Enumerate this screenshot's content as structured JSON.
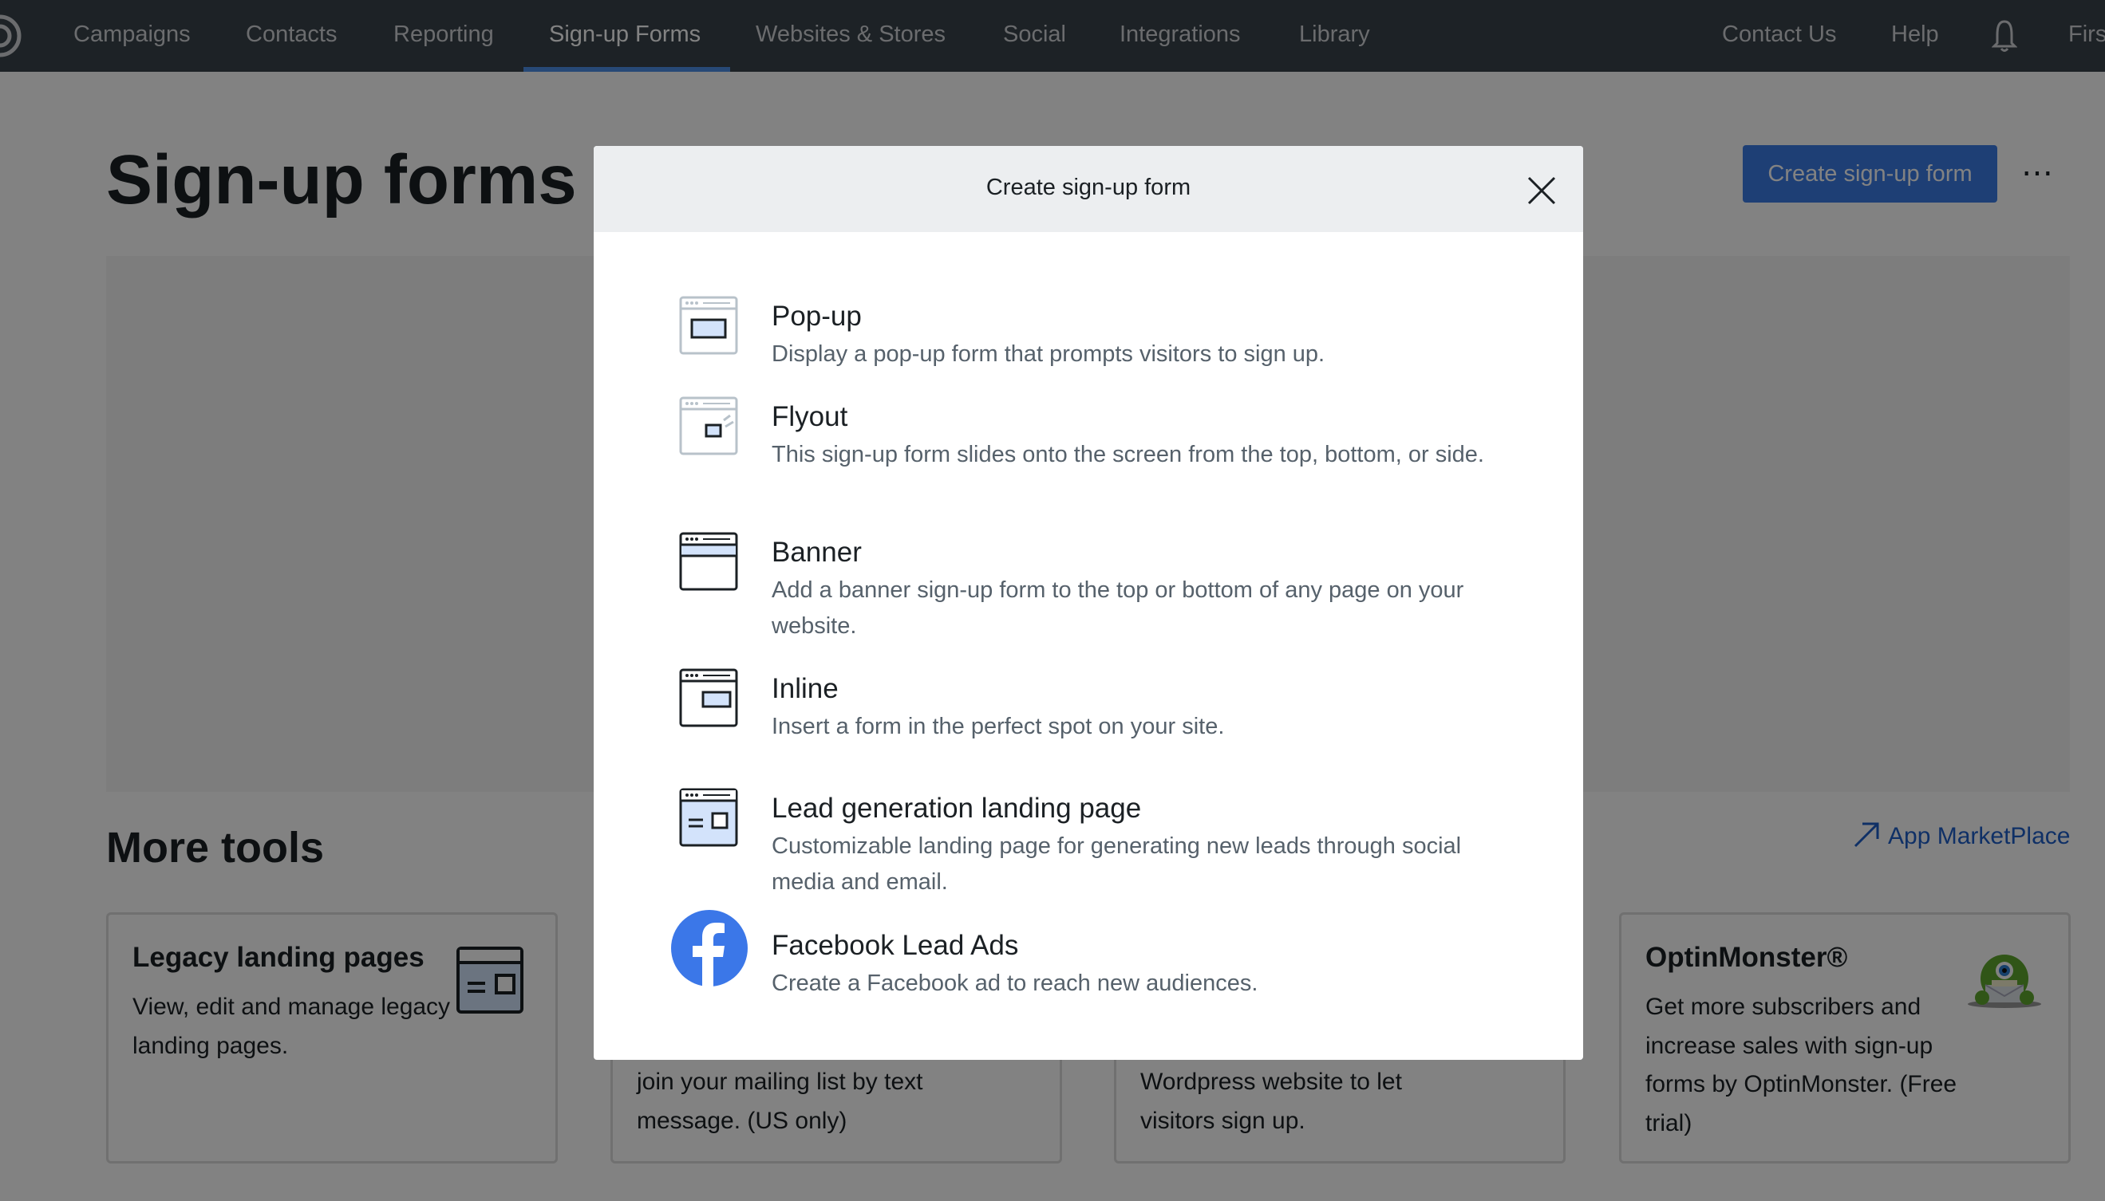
{
  "nav": {
    "items": [
      {
        "label": "Campaigns"
      },
      {
        "label": "Contacts"
      },
      {
        "label": "Reporting"
      },
      {
        "label": "Sign-up Forms",
        "active": true
      },
      {
        "label": "Websites & Stores"
      },
      {
        "label": "Social"
      },
      {
        "label": "Integrations"
      },
      {
        "label": "Library"
      }
    ],
    "contact_label": "Contact Us",
    "help_label": "Help",
    "user_label": "Firs",
    "icons": [
      "logo-icon",
      "bell-icon"
    ]
  },
  "page": {
    "title": "Sign-up forms",
    "create_button": "Create sign-up form",
    "more_title": "More tools",
    "marketplace_label": "App MarketPlace"
  },
  "cards": [
    {
      "title": "Legacy landing pages",
      "desc": "View, edit and manage legacy landing pages."
    },
    {
      "title": "",
      "desc": "join your mailing list by text message. (US only)"
    },
    {
      "title": "",
      "desc": "Wordpress website to let visitors sign up."
    },
    {
      "title": "OptinMonster®",
      "desc": "Get more subscribers and increase sales with sign-up forms by OptinMonster. (Free trial)"
    }
  ],
  "modal": {
    "title": "Create sign-up form",
    "options": [
      {
        "title": "Pop-up",
        "desc": "Display a pop-up form that prompts visitors to sign up."
      },
      {
        "title": "Flyout",
        "desc": "This sign-up form slides onto the screen from the top, bottom, or side."
      },
      {
        "title": "Banner",
        "desc": "Add a banner sign-up form to the top or bottom of any page on your website."
      },
      {
        "title": "Inline",
        "desc": "Insert a form in the perfect spot on your site."
      },
      {
        "title": "Lead generation landing page",
        "desc": "Customizable landing page for generating new leads through social media and email."
      },
      {
        "title": "Facebook Lead Ads",
        "desc": "Create a Facebook ad to reach new audiences."
      }
    ]
  },
  "colors": {
    "accent": "#3b7de6",
    "facebook": "#3b77e8",
    "icon_fill": "#d3e3fb"
  }
}
